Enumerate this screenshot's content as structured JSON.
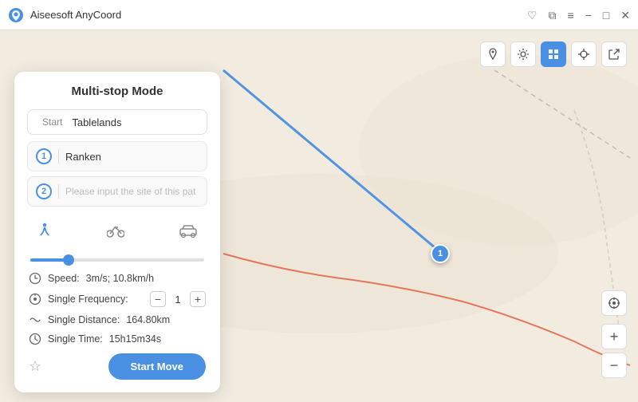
{
  "app": {
    "title": "Aiseesoft AnyCoord",
    "logo_symbol": "📍"
  },
  "titlebar": {
    "controls": {
      "heart_icon": "♡",
      "window_icon": "⧉",
      "menu_icon": "≡",
      "minimize_label": "−",
      "maximize_label": "□",
      "close_label": "✕"
    }
  },
  "toolbar": {
    "buttons": [
      {
        "name": "pin-icon",
        "symbol": "📍",
        "active": false
      },
      {
        "name": "settings-icon",
        "symbol": "⚙",
        "active": false
      },
      {
        "name": "grid-icon",
        "symbol": "⊞",
        "active": true
      },
      {
        "name": "crosshair-icon",
        "symbol": "⊕",
        "active": false
      },
      {
        "name": "export-icon",
        "symbol": "⬡",
        "active": false
      }
    ]
  },
  "panel": {
    "title": "Multi-stop Mode",
    "start_label": "Start",
    "start_value": "Tablelands",
    "start_placeholder": "Tablelands",
    "waypoints": [
      {
        "num": "1",
        "value": "Ranken",
        "placeholder": ""
      },
      {
        "num": "2",
        "value": "",
        "placeholder": "Please input the site of this pat"
      }
    ],
    "transport_modes": [
      {
        "name": "walk",
        "icon": "🚶",
        "active": true
      },
      {
        "name": "bike",
        "icon": "🚴",
        "active": false
      },
      {
        "name": "car",
        "icon": "🚗",
        "active": false
      }
    ],
    "speed_label": "Speed:",
    "speed_value": "3m/s; 10.8km/h",
    "frequency_label": "Single Frequency:",
    "frequency_value": "1",
    "distance_label": "Single Distance:",
    "distance_value": "164.80km",
    "time_label": "Single Time:",
    "time_value": "15h15m34s",
    "start_move_label": "Start Move",
    "star_icon": "☆"
  },
  "zoom": {
    "plus_label": "+",
    "minus_label": "−"
  },
  "map": {
    "marker_label": "1"
  }
}
